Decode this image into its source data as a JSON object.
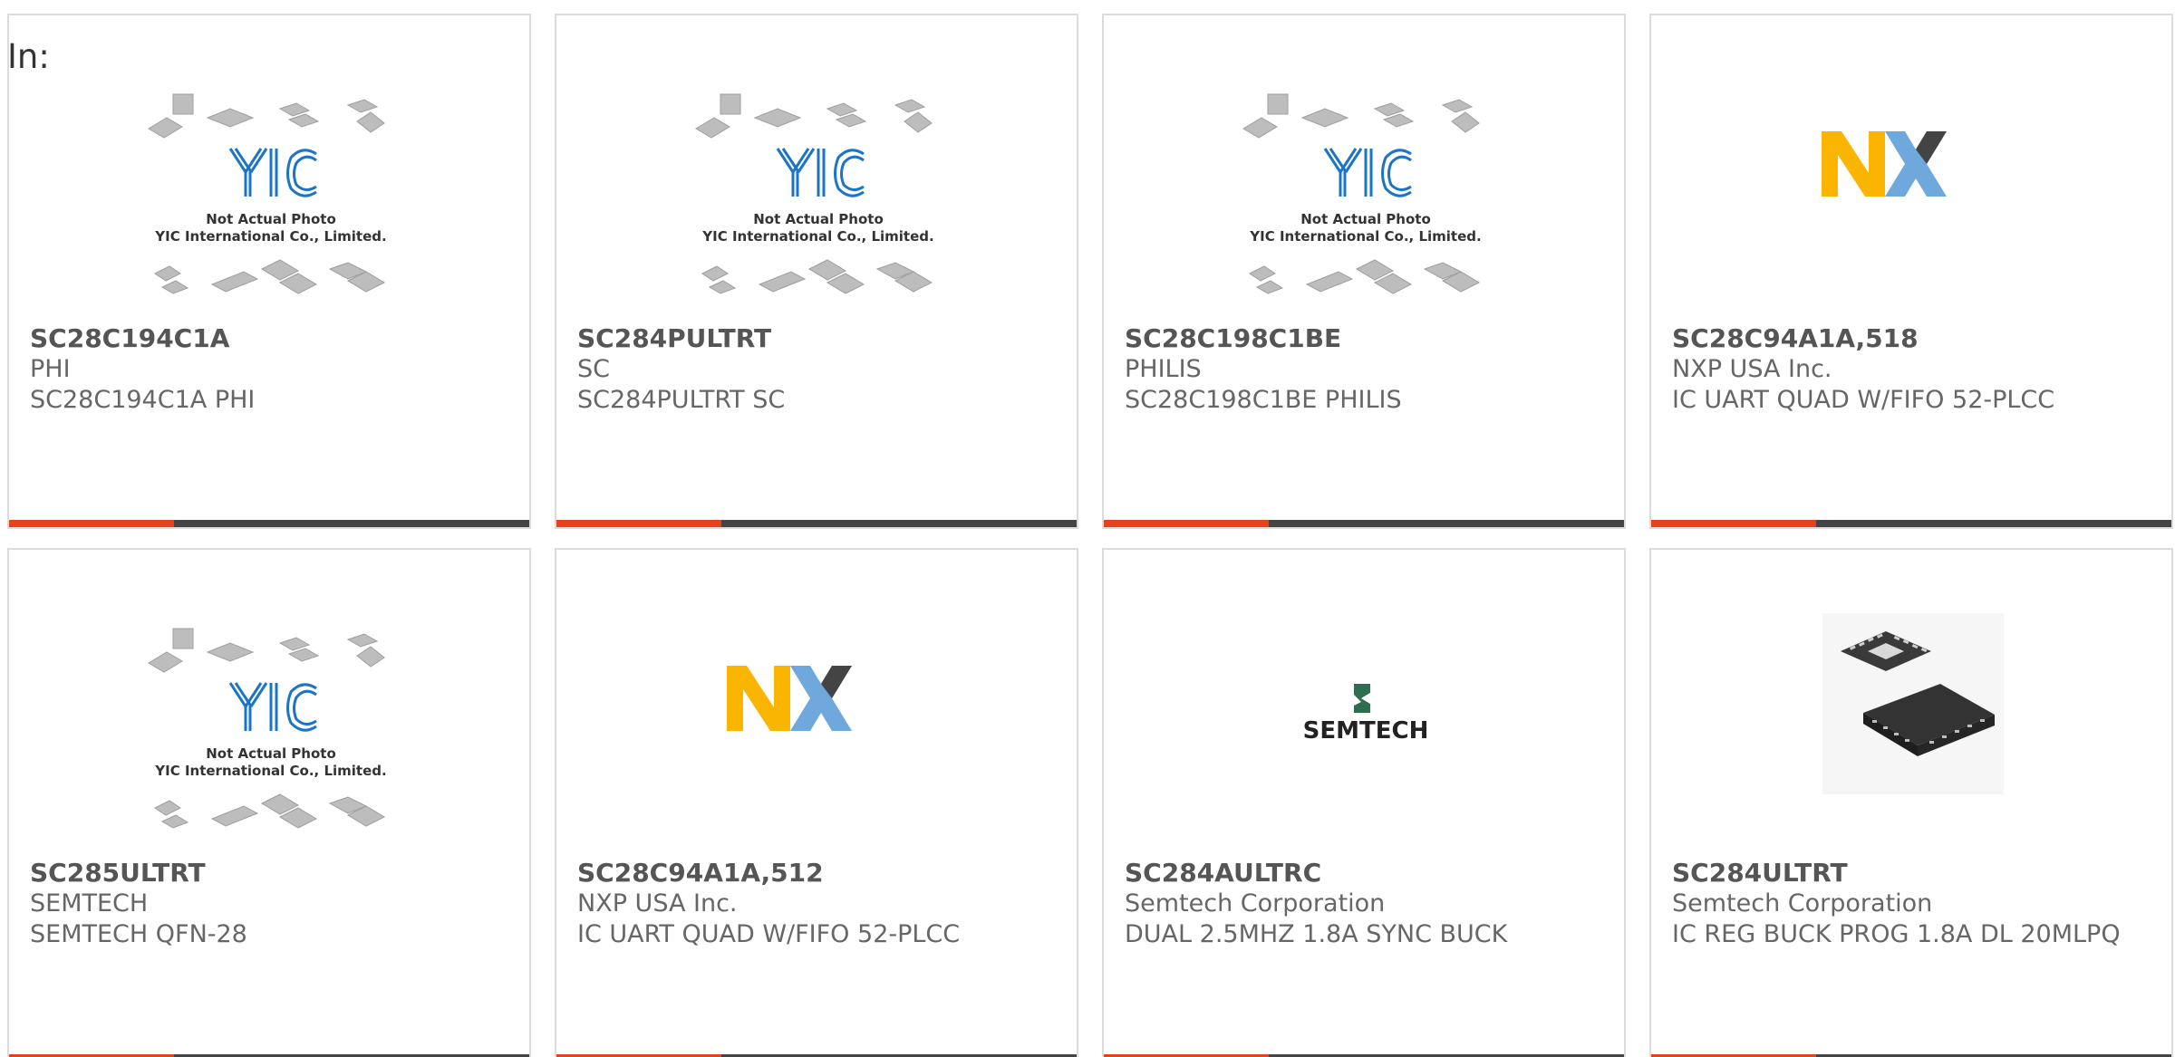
{
  "page": {
    "in_label": "In:"
  },
  "colors": {
    "accent": "#e4431b",
    "bar": "#444444",
    "part_text": "#555555",
    "body_text": "#666666",
    "card_border": "#dcdcdc"
  },
  "placeholder": {
    "line1": "Not Actual Photo",
    "line2": "YIC International Co., Limited.",
    "logo": "YIC"
  },
  "brand_logos": {
    "nxp": "NXP",
    "semtech": "SEMTECH"
  },
  "products": [
    {
      "part": "SC28C194C1A",
      "manufacturer": "PHI",
      "description": "SC28C194C1A PHI",
      "image": "yic-placeholder"
    },
    {
      "part": "SC284PULTRT",
      "manufacturer": "SC",
      "description": "SC284PULTRT SC",
      "image": "yic-placeholder"
    },
    {
      "part": "SC28C198C1BE",
      "manufacturer": "PHILIS",
      "description": "SC28C198C1BE PHILIS",
      "image": "yic-placeholder"
    },
    {
      "part": "SC28C94A1A,518",
      "manufacturer": "NXP USA Inc.",
      "description": "IC UART QUAD W/FIFO 52-PLCC",
      "image": "nxp-logo"
    },
    {
      "part": "SC285ULTRT",
      "manufacturer": "SEMTECH",
      "description": "SEMTECH QFN-28",
      "image": "yic-placeholder"
    },
    {
      "part": "SC28C94A1A,512",
      "manufacturer": "NXP USA Inc.",
      "description": "IC UART QUAD W/FIFO 52-PLCC",
      "image": "nxp-logo"
    },
    {
      "part": "SC284AULTRC",
      "manufacturer": "Semtech Corporation",
      "description": "DUAL 2.5MHZ 1.8A SYNC BUCK",
      "image": "semtech-logo"
    },
    {
      "part": "SC284ULTRT",
      "manufacturer": "Semtech Corporation",
      "description": "IC REG BUCK PROG 1.8A DL 20MLPQ",
      "image": "qfn-chip-photo"
    }
  ]
}
